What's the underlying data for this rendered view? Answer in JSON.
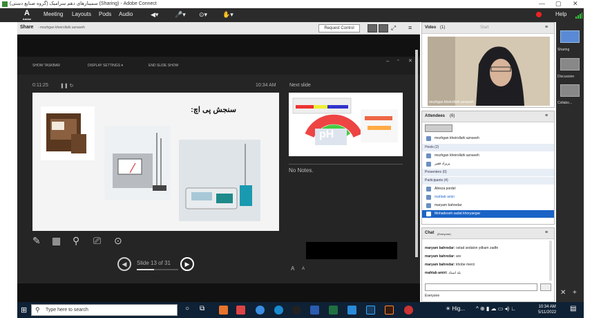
{
  "window": {
    "title": "سمینار‌های دهم سرامیک (گروه صنایع دستی) (Sharing) - Adobe Connect",
    "controls": [
      "—",
      "▢",
      "✕"
    ]
  },
  "menubar": {
    "logo_label": "Adobe",
    "items": [
      "Meeting",
      "Layouts",
      "Pods",
      "Audio"
    ],
    "help": "Help"
  },
  "share_pod": {
    "title": "Share",
    "subtitle": "- mozhgan kheirollahi aznaveh",
    "request_control": "Request Control",
    "toolbar": [
      "SHOW TASKBAR",
      "DISPLAY SETTINGS ▾",
      "END SLIDE SHOW"
    ],
    "elapsed": "0:11:25",
    "clock": "10:34 AM",
    "slide_title": "سنجش پی اچ:",
    "next_slide_label": "Next slide",
    "ph_text": "pH",
    "notes": "No Notes.",
    "slide_counter": "Slide 13 of 31",
    "progress": 0.42,
    "font_buttons": [
      "A",
      "A"
    ]
  },
  "video_pod": {
    "title": "Video",
    "count": "(1)",
    "start": "Start",
    "cam_name": "mozhgan kheirollahi aznaveh"
  },
  "attendees_pod": {
    "title": "Attendees",
    "count": "(6)",
    "me": "mozhgan kheirollahi aznaveh",
    "hosts_label": "Hosts (2)",
    "hosts": [
      "mozhgan kheirollahi aznaveh",
      "پریزاد فقیر"
    ],
    "presenters_label": "Presenters (0)",
    "participants_label": "Participants (4)",
    "participants": [
      "Alireza pordel",
      "mahtab amiri",
      "maryam bahredar",
      "Mohadeseh sadat khoryaegar"
    ]
  },
  "chat_pod": {
    "title": "Chat",
    "scope": "(Everyone)",
    "messages": [
      {
        "who": "maryam bahredar:",
        "text": "ostad sedaton ydkam zadfe"
      },
      {
        "who": "maryam bahredar:",
        "text": "are"
      },
      {
        "who": "maryam bahredar:",
        "text": "khobe merci"
      },
      {
        "who": "mahtab amiri:",
        "text": "بله استاد"
      }
    ],
    "recipient": "Everyone"
  },
  "layouts": [
    "Sharing",
    "Discussion",
    "Collabo..."
  ],
  "taskbar": {
    "search_placeholder": "Type here to search",
    "weather": "Hig...",
    "time": "10:34 AM",
    "date": "5/11/2022"
  },
  "colors": {
    "selected": "#1a63c6",
    "taskbar": "#0f2135",
    "dark": "#2b2b2b"
  }
}
